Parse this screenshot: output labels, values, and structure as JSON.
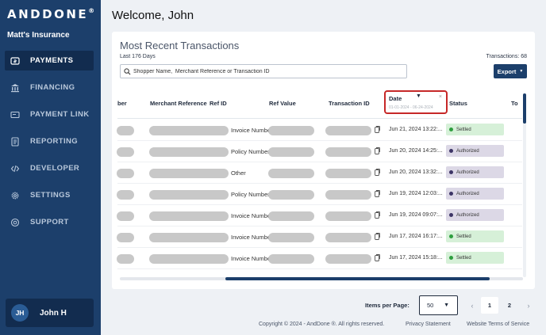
{
  "brand": {
    "logo": "ANDDONE",
    "reg": "®",
    "org": "Matt's Insurance"
  },
  "sidebar": {
    "items": [
      {
        "label": "PAYMENTS",
        "icon": "payments-icon",
        "active": true
      },
      {
        "label": "FINANCING",
        "icon": "bank-icon",
        "active": false
      },
      {
        "label": "PAYMENT LINK",
        "icon": "payment-link-icon",
        "active": false
      },
      {
        "label": "REPORTING",
        "icon": "report-icon",
        "active": false
      },
      {
        "label": "DEVELOPER",
        "icon": "code-icon",
        "active": false
      },
      {
        "label": "SETTINGS",
        "icon": "gear-icon",
        "active": false
      },
      {
        "label": "SUPPORT",
        "icon": "support-icon",
        "active": false
      }
    ],
    "user": {
      "initials": "JH",
      "name": "John H"
    }
  },
  "header": {
    "welcome": "Welcome, John"
  },
  "transactions": {
    "title": "Most Recent Transactions",
    "subtitle": "Last 176 Days",
    "count_label": "Transactions: 68",
    "search_placeholder": "Shopper Name,  Merchant Reference or Transaction ID",
    "export_label": "Export",
    "columns": {
      "shopper": "ber",
      "merchant_reference": "Merchant Reference",
      "ref_id": "Ref ID",
      "ref_value": "Ref Value",
      "transaction_id": "Transaction ID",
      "date": "Date",
      "status": "Status",
      "total": "To"
    },
    "date_filter": {
      "range_placeholder": "01-01-2024 - 06-24-2024"
    },
    "rows": [
      {
        "ref_id": "Invoice Number",
        "date": "Jun 21, 2024 13:22:...",
        "status": "Settled",
        "status_type": "settled"
      },
      {
        "ref_id": "Policy Number",
        "date": "Jun 20, 2024 14:25:...",
        "status": "Authorized",
        "status_type": "authorized"
      },
      {
        "ref_id": "Other",
        "date": "Jun 20, 2024 13:32:...",
        "status": "Authorized",
        "status_type": "authorized"
      },
      {
        "ref_id": "Policy Number",
        "date": "Jun 19, 2024 12:03:...",
        "status": "Authorized",
        "status_type": "authorized"
      },
      {
        "ref_id": "Invoice Number",
        "date": "Jun 19, 2024 09:07:...",
        "status": "Authorized",
        "status_type": "authorized"
      },
      {
        "ref_id": "Invoice Number",
        "date": "Jun 17, 2024 16:17:...",
        "status": "Settled",
        "status_type": "settled"
      },
      {
        "ref_id": "Invoice Number",
        "date": "Jun 17, 2024 15:18:...",
        "status": "Settled",
        "status_type": "settled"
      }
    ]
  },
  "pagination": {
    "items_per_page_label": "Items per Page:",
    "items_per_page_value": "50",
    "prev": "‹",
    "next": "›",
    "pages": [
      "1",
      "2"
    ],
    "current_page": "1"
  },
  "footer": {
    "copyright": "Copyright © 2024 - AndDone ®. All rights reserved.",
    "privacy": "Privacy Statement",
    "terms": "Website Terms of Service"
  },
  "colors": {
    "sidebar_bg": "#1c3f6b",
    "active_nav_bg": "#122c4f",
    "settled_bg": "#d6f0d8",
    "authorized_bg": "#dcd8e6",
    "highlight_border": "#c62828"
  }
}
